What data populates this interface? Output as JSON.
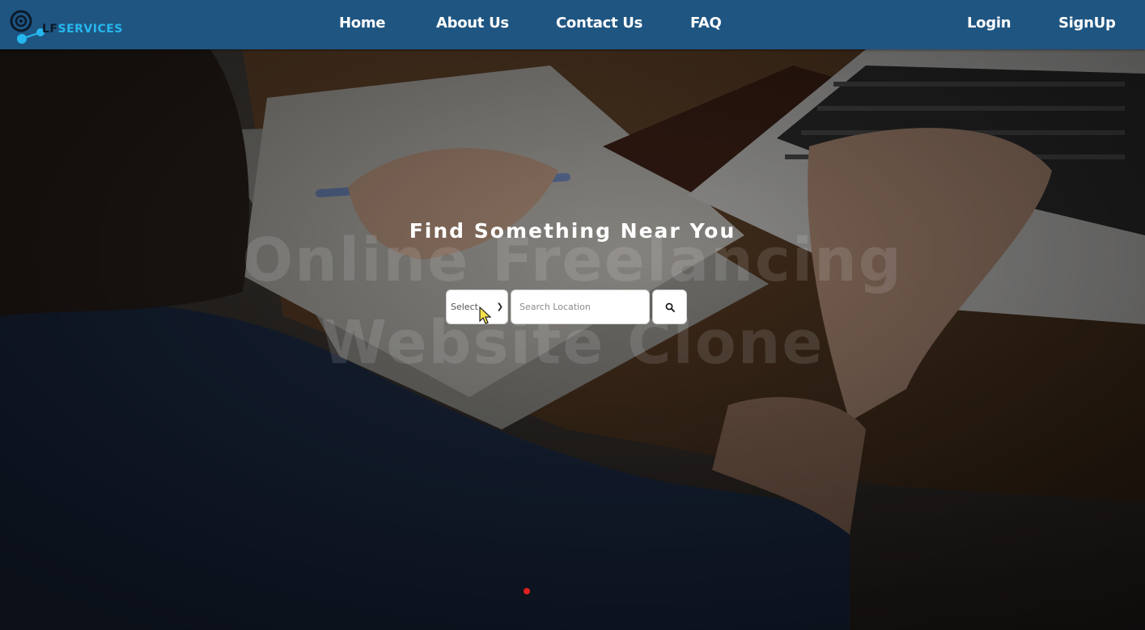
{
  "brand": {
    "prefix": "LF",
    "name": "SERVICES"
  },
  "nav": {
    "links": [
      "Home",
      "About Us",
      "Contact Us",
      "FAQ"
    ],
    "login": "Login",
    "signup": "SignUp"
  },
  "hero": {
    "title": "Find Something Near You",
    "watermark_line1": "Online Freelancing",
    "watermark_line2": "Website Clone",
    "category_select": {
      "value": "Select"
    },
    "location_input": {
      "value": "",
      "placeholder": "Search Location"
    },
    "search_icon": "search-icon",
    "carousel": {
      "active_index": 0,
      "count": 1
    }
  },
  "colors": {
    "navbar": "#1f5581",
    "brand_accent": "#26b7ef",
    "nav_text": "#ffffff",
    "dot_active": "#e0201f"
  }
}
